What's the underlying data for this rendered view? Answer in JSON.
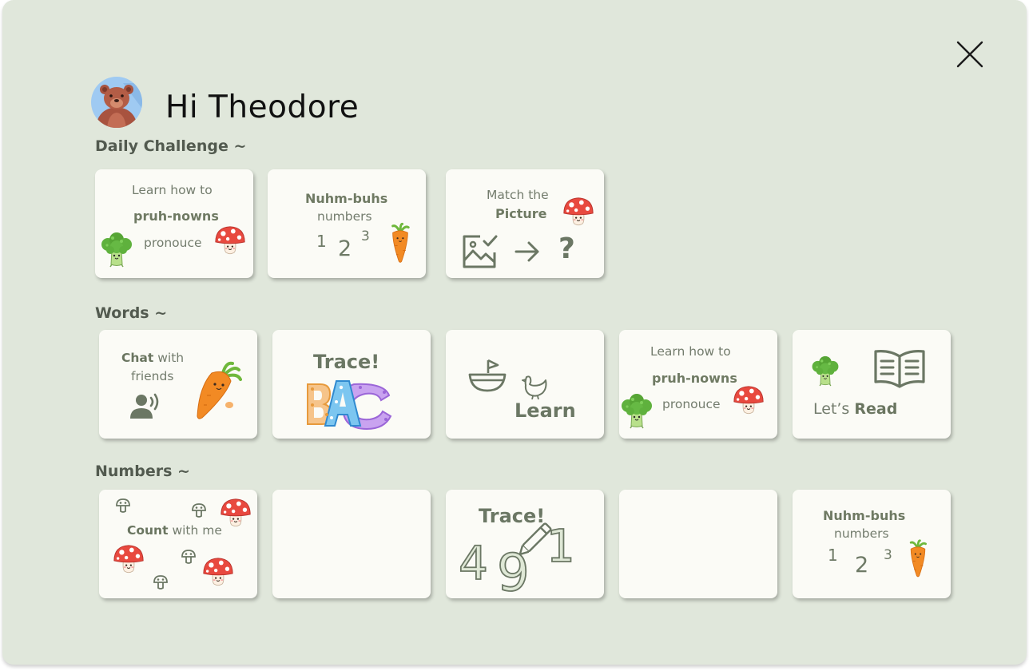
{
  "greeting": "Hi Theodore",
  "icons": {
    "close": "close-icon",
    "avatar": "bear-avatar",
    "broccoli": "broccoli-icon",
    "mushroom": "mushroom-icon",
    "carrot": "carrot-icon",
    "image_check": "image-check-icon",
    "arrow": "arrow-right-icon",
    "question": "question-mark-icon",
    "speaker": "person-speaking-icon",
    "abc": "abc-letters-icon",
    "boat": "boat-icon",
    "chicken": "chicken-icon",
    "book": "open-book-icon",
    "pencil": "pencil-icon"
  },
  "colors": {
    "background": "#e0e7db",
    "card": "#fbfbf6",
    "accent": "#6b7764"
  },
  "sections": {
    "daily": {
      "title": "Daily Challenge ~",
      "cards": [
        {
          "line1": "Learn how to",
          "bold": "pruh-nowns",
          "line3": "pronouce"
        },
        {
          "bold": "Nuhm-buhs",
          "line2": "numbers",
          "n1": "1",
          "n2": "2",
          "n3": "3"
        },
        {
          "line1": "Match the",
          "bold": "Picture",
          "q": "?"
        }
      ]
    },
    "words": {
      "title": "Words ~",
      "cards": [
        {
          "bold": "Chat",
          "rest": " with",
          "line2": "friends"
        },
        {
          "title": "Trace!",
          "letters": [
            "B",
            "A",
            "C"
          ]
        },
        {
          "label": "Learn"
        },
        {
          "line1": "Learn how to",
          "bold": "pruh-nowns",
          "line3": "pronouce"
        },
        {
          "prefix": "Let’s ",
          "bold": "Read"
        }
      ]
    },
    "numbers": {
      "title": "Numbers ~",
      "cards": [
        {
          "bold": "Count",
          "rest": " with me"
        },
        {},
        {
          "title": "Trace!",
          "d1": "4",
          "d2": "9",
          "d3": "1"
        },
        {},
        {
          "bold": "Nuhm-buhs",
          "line2": "numbers",
          "n1": "1",
          "n2": "2",
          "n3": "3"
        }
      ]
    }
  }
}
